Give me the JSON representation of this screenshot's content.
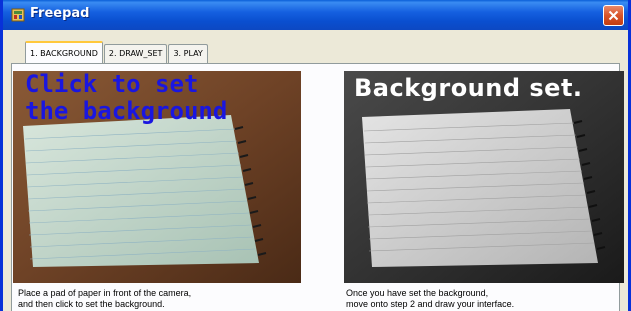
{
  "window": {
    "title": "Freepad",
    "accent": "#0a4fd0",
    "close_color": "#d8542a"
  },
  "tabs": [
    {
      "label": "1. BACKGROUND",
      "active": true
    },
    {
      "label": "2. DRAW_SET",
      "active": false
    },
    {
      "label": "3. PLAY",
      "active": false
    }
  ],
  "left_panel": {
    "overlay_line1": "Click to set",
    "overlay_line2": "the background",
    "overlay_color": "#1a16e0",
    "caption_line1": "Place a pad of paper in front of the camera,",
    "caption_line2": "and then click to set the background."
  },
  "right_panel": {
    "overlay": "Background set.",
    "caption_line1": "Once you have set the background,",
    "caption_line2": "move onto step 2 and draw your interface."
  },
  "icons": {
    "app": "freepad-app-icon",
    "close": "close-icon"
  }
}
